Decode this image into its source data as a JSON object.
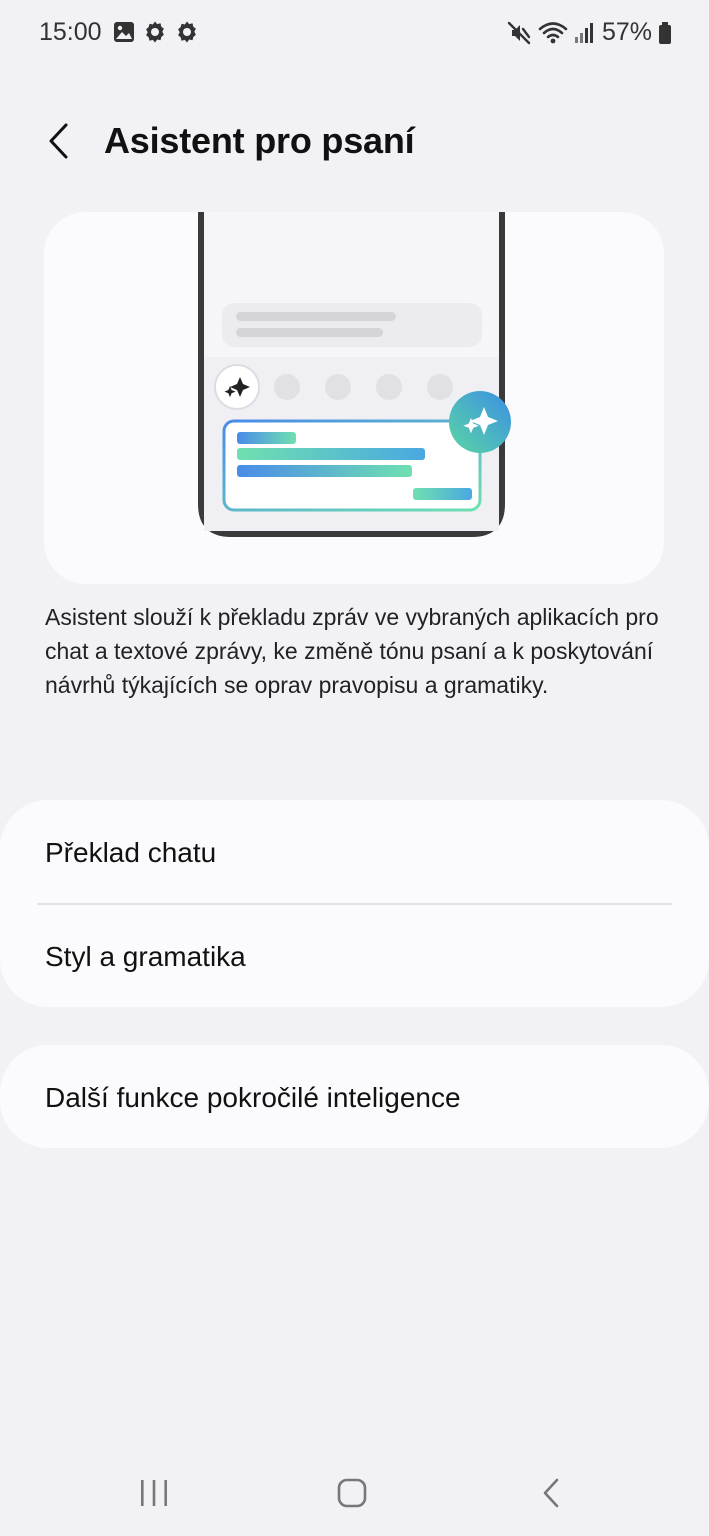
{
  "status_bar": {
    "time": "15:00",
    "battery": "57%",
    "left_icons": [
      "gallery-icon",
      "settings-icon",
      "settings-icon"
    ],
    "right_icons": [
      "mute-icon",
      "wifi-icon",
      "signal-icon",
      "battery-icon"
    ]
  },
  "header": {
    "title": "Asistent pro psaní",
    "back_icon": "back-arrow-icon"
  },
  "hero": {
    "illustration": "phone-keyboard-assistant-illustration",
    "icons": [
      "sparkle-icon",
      "sparkle-badge-icon"
    ]
  },
  "description": "Asistent slouží k překladu zpráv ve vybraných aplikacích pro chat a textové zprávy, ke změně tónu psaní a k poskytování návrhů týkajících se oprav pravopisu a gramatiky.",
  "menu": {
    "group1": [
      {
        "label": "Překlad chatu"
      },
      {
        "label": "Styl a gramatika"
      }
    ],
    "group2": [
      {
        "label": "Další funkce pokročilé inteligence"
      }
    ]
  },
  "navigation": {
    "buttons": [
      "recents-icon",
      "home-icon",
      "back-icon"
    ]
  },
  "colors": {
    "background": "#f2f2f6",
    "card": "#fbfbfd",
    "accent_gradient_start": "#4a8be8",
    "accent_gradient_end": "#6fe0b0"
  }
}
